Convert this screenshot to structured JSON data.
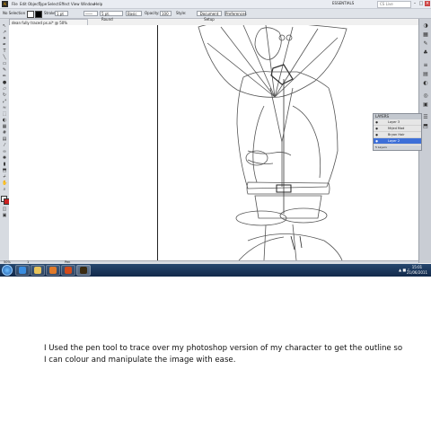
{
  "app": {
    "logo": "Ai",
    "menu": [
      "File",
      "Edit",
      "Object",
      "Type",
      "Select",
      "Effect",
      "View",
      "Window",
      "Help"
    ],
    "workspace": "ESSENTIALS",
    "search_placeholder": "CS Live"
  },
  "control_bar": {
    "selection_label": "No Selection",
    "stroke_label": "Stroke:",
    "stroke_weight": "1 pt",
    "brush_label": "5 pt. Round",
    "style_label": "Basic",
    "opacity_label": "Opacity:",
    "opacity_value": "100",
    "style2_label": "Style:",
    "doc_setup_button": "Document Setup",
    "preferences_button": "Preferences"
  },
  "document": {
    "tab_label": "dean fully traced ps.ai* @ 50% (RGB/Preview)"
  },
  "layers_panel": {
    "title": "LAYERS",
    "layers": [
      {
        "name": "Layer 3",
        "selected": false
      },
      {
        "name": "Mrjed Mad",
        "selected": false
      },
      {
        "name": "Bryan Hair",
        "selected": false
      },
      {
        "name": "Layer 2",
        "selected": true
      },
      {
        "name": "Layer 1",
        "selected": false
      }
    ],
    "footer": "5 Layers"
  },
  "status_bar": {
    "zoom": "50%",
    "page": "1",
    "tool": "Pen"
  },
  "taskbar": {
    "time": "15:01",
    "date": "21/06/2011",
    "tray": "▲ ■ ♪"
  },
  "caption": "I Used the pen tool to trace over my photoshop version of my character to get the outline so I can colour and manipulate the image with ease.",
  "colors": {
    "taskbar": "#1b3a60",
    "selected_layer": "#3d6fd8",
    "canvas": "#ffffff"
  }
}
